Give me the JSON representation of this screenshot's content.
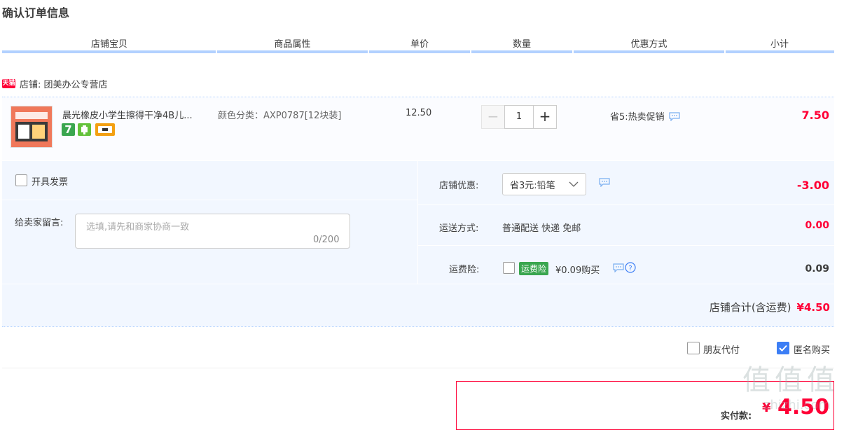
{
  "page_title": "确认订单信息",
  "columns": [
    "店铺宝贝",
    "商品属性",
    "单价",
    "数量",
    "优惠方式",
    "小计"
  ],
  "shop": {
    "badge": "天猫",
    "label": "店铺: 团美办公专营店"
  },
  "item": {
    "title": "晨光橡皮小学生擦得干净4B儿...",
    "attribute": "颜色分类：AXP0787[12块装]",
    "unit_price": "12.50",
    "quantity": "1",
    "minus": "−",
    "plus": "+",
    "promotion": "省5:热卖促销",
    "subtotal": "7.50",
    "badges": [
      {
        "icon": "seven-day-return-icon",
        "text": "7",
        "color": "#3aa64f"
      },
      {
        "icon": "protection-icon",
        "color": "#63c23a"
      },
      {
        "icon": "card-pay-icon",
        "color": "#f3a012"
      }
    ]
  },
  "invoice": {
    "label": "开具发票"
  },
  "memo": {
    "label": "给卖家留言:",
    "placeholder": "选填,请先和商家协商一致",
    "count": "0/200"
  },
  "shop_discount": {
    "label": "店铺优惠:",
    "selected": "省3元:铅笔",
    "value": "-3.00"
  },
  "shipping": {
    "label": "运送方式:",
    "value_text": "普通配送 快递 免邮",
    "value": "0.00"
  },
  "insurance": {
    "label": "运费险:",
    "tag": "运费险",
    "price_text": "¥0.09购买",
    "value": "0.09"
  },
  "shop_total": {
    "label": "店铺合计(含运费)",
    "value": "¥4.50"
  },
  "options": {
    "friend_pay": "朋友代付",
    "anonymous": "匿名购买"
  },
  "pay": {
    "label": "实付款:",
    "currency": "¥",
    "amount": "4.50"
  },
  "watermark": {
    "text": "值",
    "url": "zhizhi.com"
  },
  "colors": {
    "accent_red": "#ff0036",
    "header_bar": "#b2d1ff",
    "panel_bg": "#f2f7ff",
    "check_blue": "#3c7ef5"
  }
}
